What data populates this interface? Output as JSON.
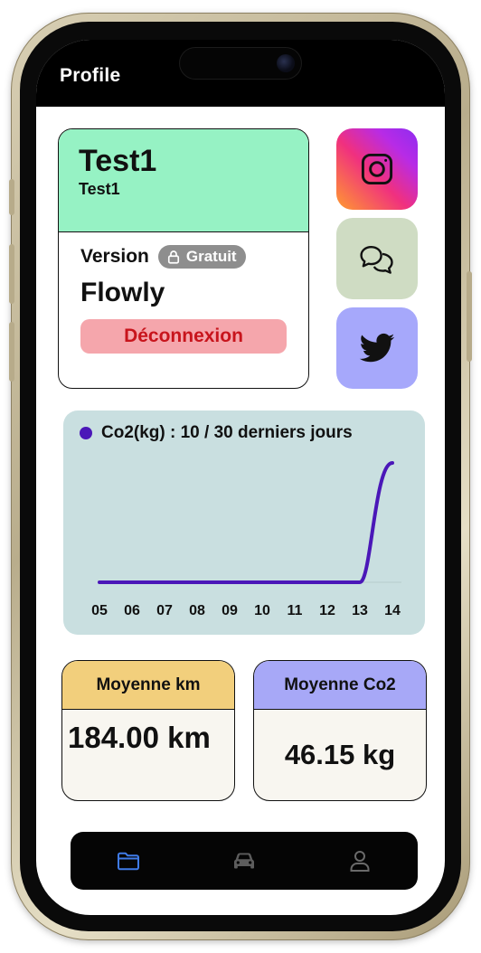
{
  "header": {
    "title": "Profile"
  },
  "profile": {
    "name": "Test1",
    "username": "Test1",
    "version_label": "Version",
    "plan_badge": "Gratuit",
    "app_name": "Flowly",
    "logout_label": "Déconnexion"
  },
  "social": [
    {
      "icon": "instagram-icon"
    },
    {
      "icon": "message-icon"
    },
    {
      "icon": "twitter-icon"
    }
  ],
  "chart_data": {
    "type": "line",
    "series": [
      {
        "name": "Co2(kg) : 10 / 30 derniers jours",
        "values": [
          0,
          0,
          0,
          0,
          0,
          0,
          0,
          0,
          0,
          10
        ],
        "color": "#4a17b8"
      }
    ],
    "categories": [
      "05",
      "06",
      "07",
      "08",
      "09",
      "10",
      "11",
      "12",
      "13",
      "14"
    ],
    "ylim": [
      0,
      10
    ],
    "grid": false,
    "legend": "top-left"
  },
  "stats": {
    "km": {
      "label": "Moyenne km",
      "value": "184.00 km"
    },
    "co2": {
      "label": "Moyenne Co2",
      "value": "46.15 kg"
    }
  },
  "nav": [
    {
      "icon": "folder-icon",
      "active": true
    },
    {
      "icon": "car-icon",
      "active": false
    },
    {
      "icon": "user-icon",
      "active": false
    }
  ],
  "colors": {
    "profile_header": "#96f2c4",
    "logout_bg": "#f5a6ac",
    "logout_text": "#c8141c",
    "chart_bg": "#c9dfe0",
    "chart_line": "#4a17b8",
    "km_header": "#f2cf7c",
    "co2_header": "#a7a8f7",
    "nav_active": "#3f7be8"
  }
}
